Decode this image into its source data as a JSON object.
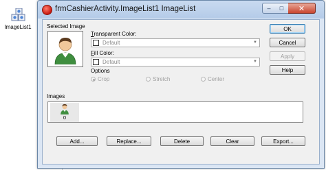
{
  "component_tray": {
    "label": "ImageList1",
    "icon": "imagelist-component-icon"
  },
  "window": {
    "title": "frmCashierActivity.ImageList1 ImageList",
    "minimize": "–",
    "maximize": "□",
    "close": "✕"
  },
  "selected_image": {
    "label": "Selected Image",
    "icon": "person-icon"
  },
  "transparent_color": {
    "label": "Transparent Color:",
    "access_key": "T",
    "label_rest": "ransparent Color:",
    "value": "Default"
  },
  "fill_color": {
    "label": "Fill Color:",
    "access_key": "F",
    "label_rest": "ill Color:",
    "value": "Default"
  },
  "options": {
    "label": "Options",
    "radios": [
      {
        "label": "Crop",
        "selected": true
      },
      {
        "label": "Stretch",
        "selected": false
      },
      {
        "label": "Center",
        "selected": false
      }
    ]
  },
  "side_buttons": {
    "ok": "OK",
    "cancel": "Cancel",
    "apply": "Apply",
    "help": "Help"
  },
  "images": {
    "label": "Images",
    "items": [
      {
        "index": "0",
        "icon": "person-icon"
      }
    ]
  },
  "bottom_buttons": {
    "add": "Add...",
    "replace": "Replace...",
    "delete": "Delete",
    "clear": "Clear",
    "export": "Export..."
  },
  "colors": {
    "window_frame": "#dbe6f4",
    "client": "#f0f0f0",
    "close_button": "#c9452f"
  }
}
